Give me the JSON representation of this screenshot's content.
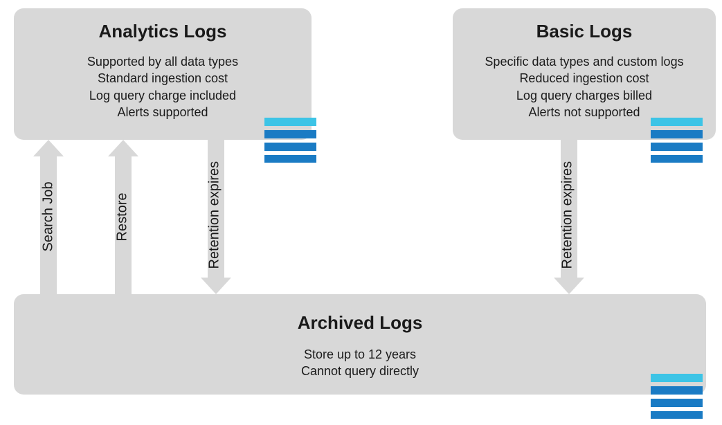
{
  "boxes": {
    "analytics": {
      "title": "Analytics Logs",
      "lines": [
        "Supported by all data types",
        "Standard ingestion cost",
        "Log query charge included",
        "Alerts supported"
      ]
    },
    "basic": {
      "title": "Basic Logs",
      "lines": [
        "Specific data types and custom logs",
        "Reduced ingestion cost",
        "Log query charges billed",
        "Alerts not supported"
      ]
    },
    "archived": {
      "title": "Archived Logs",
      "lines": [
        "Store up to 12 years",
        "Cannot query directly"
      ]
    }
  },
  "arrows": {
    "searchJob": "Search Job",
    "restore": "Restore",
    "retentionExpires1": "Retention expires",
    "retentionExpires2": "Retention expires"
  },
  "colors": {
    "boxBg": "#d8d8d8",
    "iconHeader": "#3dc4e6",
    "iconRow": "#1a7bc4"
  }
}
